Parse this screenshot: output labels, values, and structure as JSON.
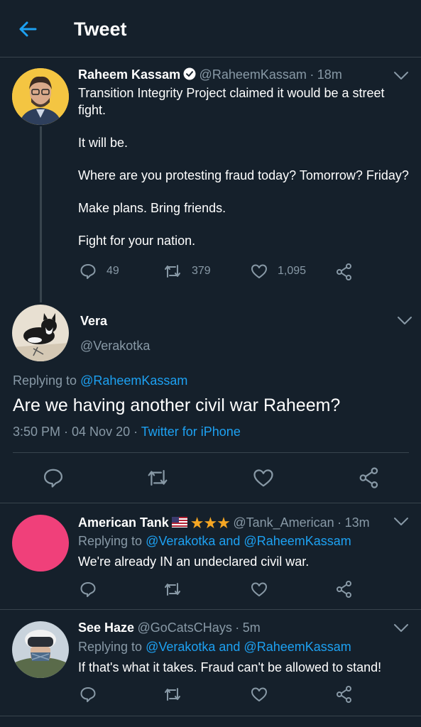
{
  "header": {
    "title": "Tweet"
  },
  "parent_tweet": {
    "name": "Raheem Kassam",
    "handle": "@RaheemKassam",
    "time": "18m",
    "paragraphs": [
      "Transition Integrity Project claimed it would be a street fight.",
      "It will be.",
      "Where are you protesting fraud today? Tomorrow? Friday?",
      "Make plans. Bring friends.",
      "Fight for your nation."
    ],
    "replies": "49",
    "retweets": "379",
    "likes": "1,095"
  },
  "main_tweet": {
    "name": "Vera",
    "handle": "@Verakotka",
    "replying_prefix": "Replying to",
    "replying_to": "@RaheemKassam",
    "text": "Are we having another civil war Raheem?",
    "timestamp": "3:50 PM · 04 Nov 20 · ",
    "source": "Twitter for iPhone"
  },
  "replies": [
    {
      "name": "American Tank",
      "stars": "★★★",
      "handle": "@Tank_American",
      "time": "13m",
      "replying_prefix": "Replying to",
      "replying_to": "@Verakotka and @RaheemKassam",
      "text": "We're already IN an undeclared civil war."
    },
    {
      "name": "See Haze",
      "handle": "@GoCatsCHays",
      "time": "5m",
      "replying_prefix": "Replying to",
      "replying_to": "@Verakotka and @RaheemKassam",
      "text": "If that's what it takes. Fraud can't be allowed to stand!"
    }
  ],
  "icons": {
    "back": "arrow-left-icon",
    "reply": "speech-bubble-icon",
    "retweet": "retweet-icon",
    "like": "heart-icon",
    "share": "share-icon",
    "verified": "verified-badge-icon",
    "more": "chevron-down-icon",
    "flag": "us-flag-icon"
  },
  "colors": {
    "background": "#15202b",
    "accent": "#1da1f2",
    "muted": "#8899a6",
    "divider": "#38444d",
    "star": "#f5a623",
    "avatar_pink": "#f0407a",
    "avatar_yellow": "#f4c542"
  }
}
